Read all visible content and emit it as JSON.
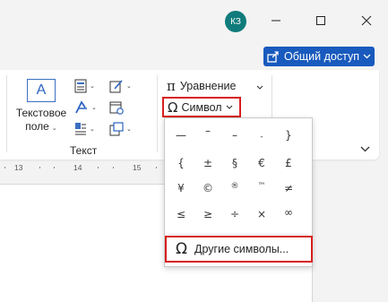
{
  "titlebar": {
    "avatar_initials": "КЗ",
    "minimize_icon": "minimize-icon",
    "maximize_icon": "maximize-icon",
    "close_icon": "close-icon"
  },
  "share": {
    "label": "Общий доступ",
    "color": "#185abd"
  },
  "ribbon": {
    "textbox_label_line1": "Текстовое",
    "textbox_label_line2": "поле",
    "group_label": "Текст",
    "equation_label": "Уравнение",
    "equation_symbol": "π",
    "symbol_label": "Символ",
    "symbol_glyph": "Ω"
  },
  "ruler": {
    "marks": [
      "13",
      "14",
      "15"
    ]
  },
  "symbols": {
    "row1": [
      "—",
      "–",
      "–",
      "‑",
      "}"
    ],
    "row2": [
      "{",
      "±",
      "§",
      "€",
      "£"
    ],
    "row3": [
      "¥",
      "©",
      "®",
      "™",
      "≠"
    ],
    "row4": [
      "≤",
      "≥",
      "÷",
      "×",
      "∞"
    ],
    "more_label": "Другие символы...",
    "more_glyph": "Ω"
  },
  "highlight_color": "#d71e1e"
}
